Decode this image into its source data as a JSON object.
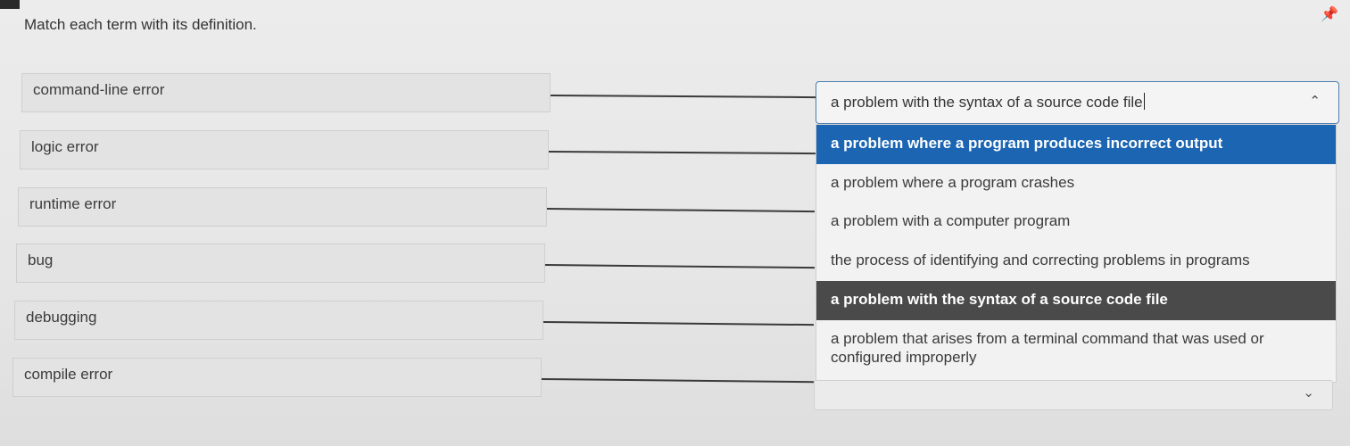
{
  "instruction": "Match each term with its definition.",
  "pin_icon": "pin-icon",
  "terms": [
    "command-line error",
    "logic error",
    "runtime error",
    "bug",
    "debugging",
    "compile error"
  ],
  "open_select": {
    "value": "a problem with the syntax of a source code file",
    "caret_icon": "chevron-up-icon"
  },
  "options": [
    "a problem where a program produces incorrect output",
    "a problem where a program crashes",
    "a problem with a computer program",
    "the process of identifying and correcting problems in programs",
    "a problem with the syntax of a source code file",
    "a problem that arises from a terminal command that was used or configured improperly"
  ],
  "highlighted_option_index": 0,
  "selected_option_index": 4,
  "colors": {
    "highlight": "#1b65b3",
    "selected": "#4a4a4a",
    "focus_border": "#4a7fb0"
  },
  "collapsed_select": {
    "value": "",
    "caret_icon": "chevron-down-icon"
  }
}
